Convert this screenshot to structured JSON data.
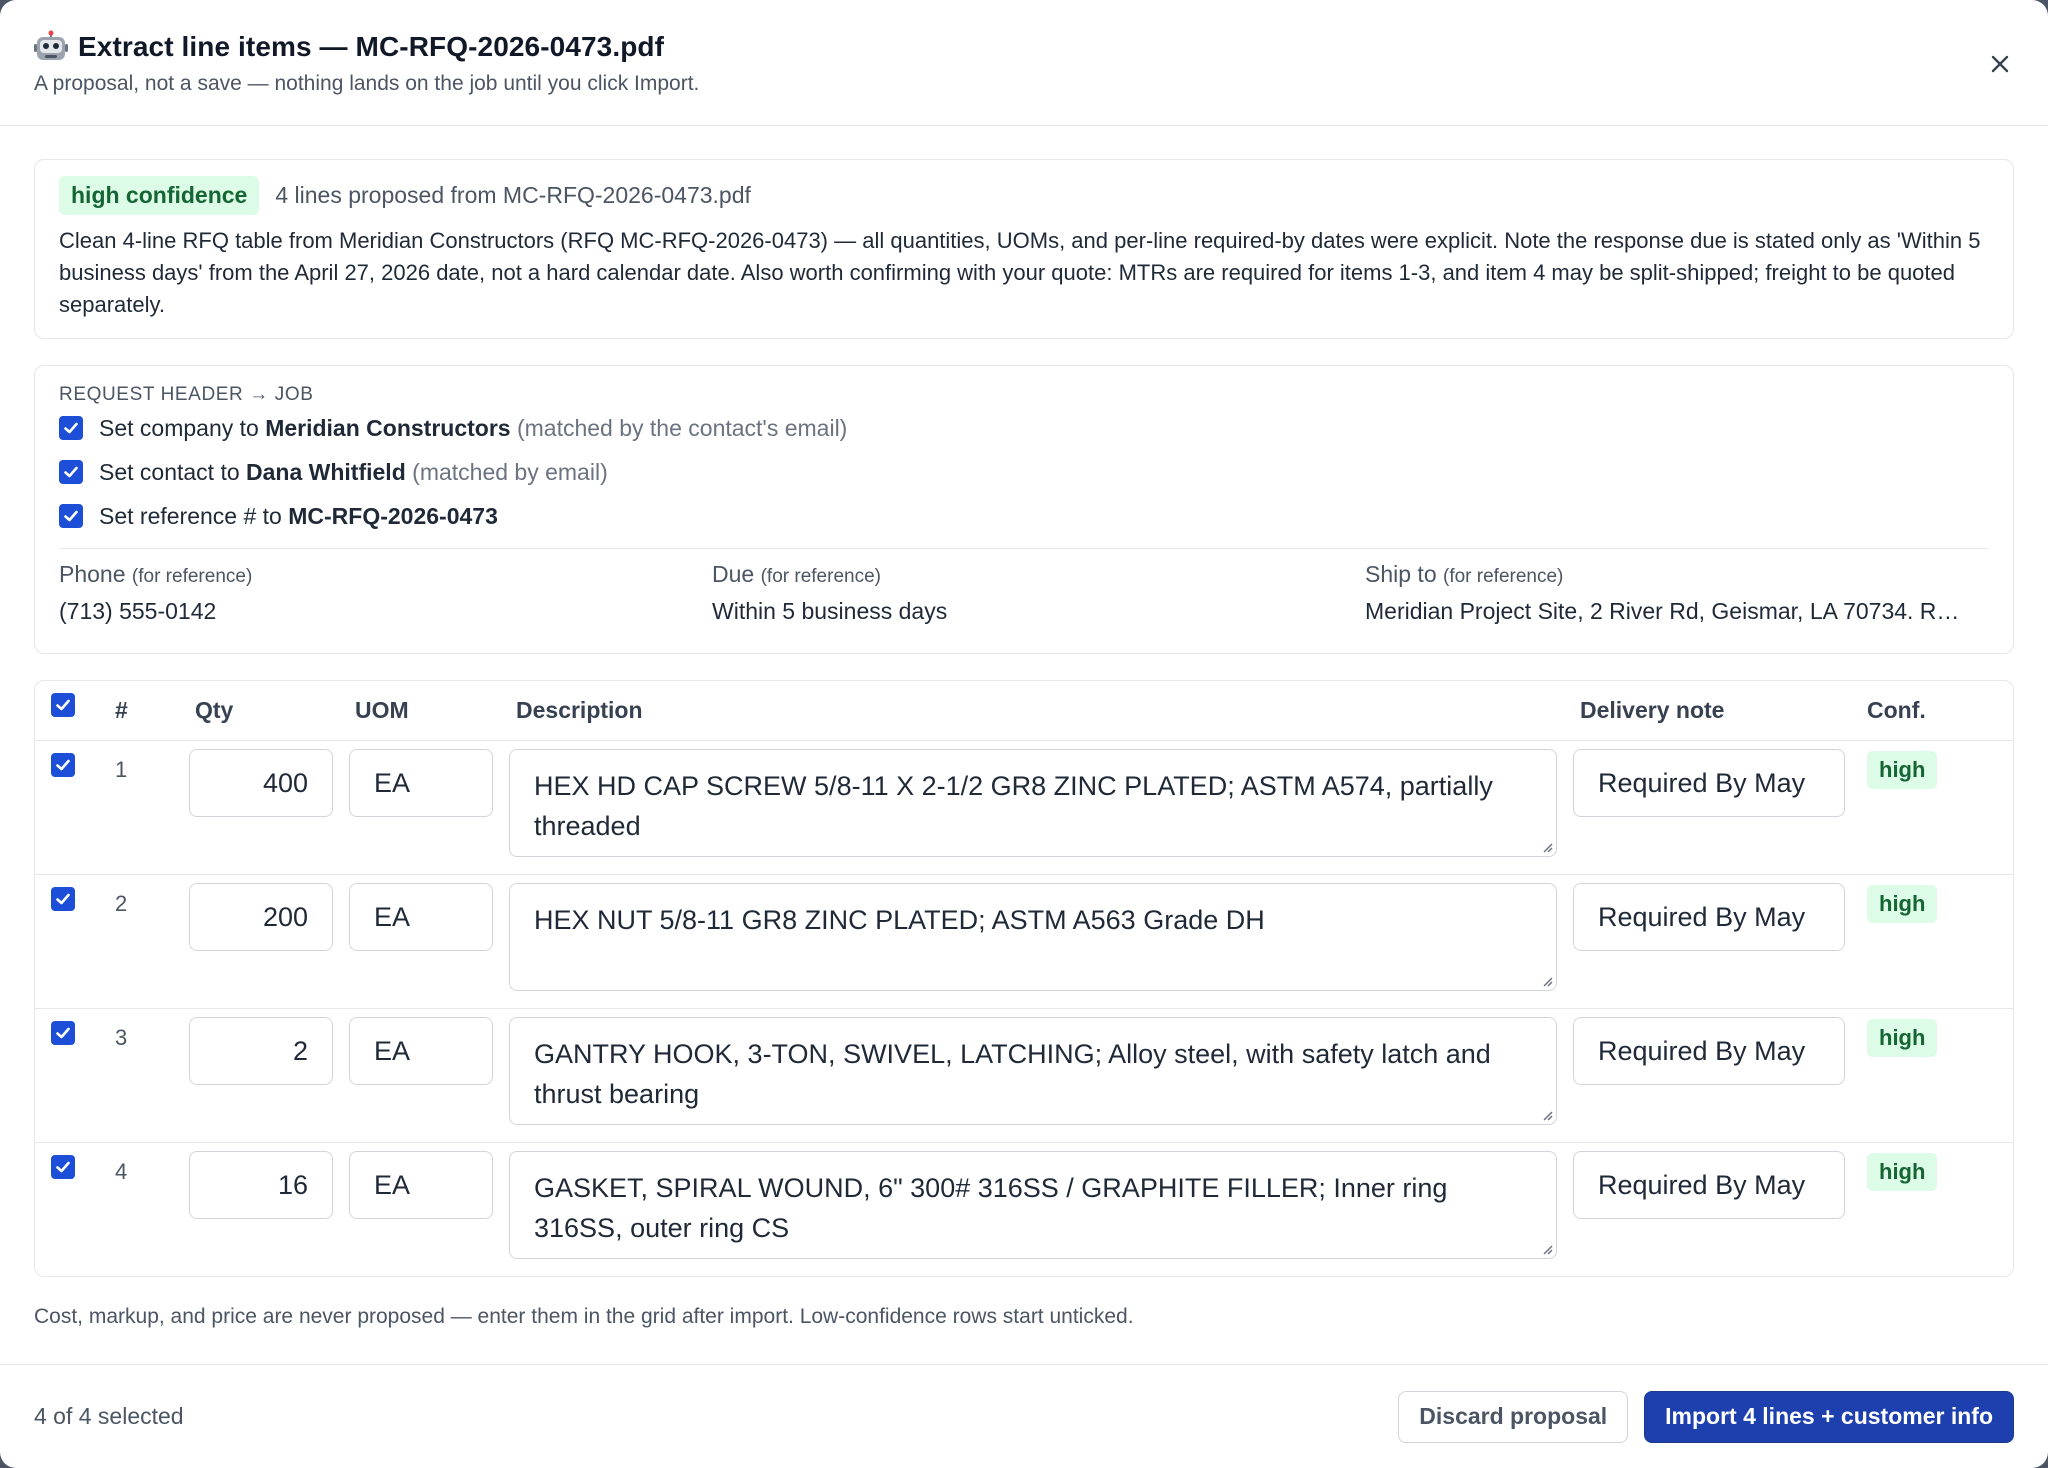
{
  "header": {
    "title": "Extract line items — MC-RFQ-2026-0473.pdf",
    "subtitle": "A proposal, not a save — nothing lands on the job until you click Import."
  },
  "summary": {
    "confidence": "high confidence",
    "meta": "4 lines proposed from MC-RFQ-2026-0473.pdf",
    "text": "Clean 4-line RFQ table from Meridian Constructors (RFQ MC-RFQ-2026-0473) — all quantities, UOMs, and per-line required-by dates were explicit. Note the response due is stated only as 'Within 5 business days' from the April 27, 2026 date, not a hard calendar date. Also worth confirming with your quote: MTRs are required for items 1-3, and item 4 may be split-shipped; freight to be quoted separately."
  },
  "request_header": {
    "label": "REQUEST HEADER → JOB",
    "company": {
      "prefix": "Set company to",
      "value": "Meridian Constructors",
      "note": "(matched by the contact's email)",
      "checked": true
    },
    "contact": {
      "prefix": "Set contact to",
      "value": "Dana Whitfield",
      "note": "(matched by email)",
      "checked": true
    },
    "reference": {
      "prefix": "Set reference # to",
      "value": "MC-RFQ-2026-0473",
      "checked": true
    },
    "refs": [
      {
        "label": "Phone",
        "note": "(for reference)",
        "value": "(713) 555-0142"
      },
      {
        "label": "Due",
        "note": "(for reference)",
        "value": "Within 5 business days"
      },
      {
        "label": "Ship to",
        "note": "(for reference)",
        "value": "Meridian Project Site, 2 River Rd, Geismar, LA 70734. R…"
      }
    ]
  },
  "table": {
    "columns": {
      "num": "#",
      "qty": "Qty",
      "uom": "UOM",
      "description": "Description",
      "delivery": "Delivery note",
      "conf": "Conf."
    },
    "rows": [
      {
        "num": "1",
        "qty": "400",
        "uom": "EA",
        "description": "HEX HD CAP SCREW 5/8-11 X 2-1/2 GR8 ZINC PLATED; ASTM A574, partially threaded",
        "delivery": "Required By May",
        "conf": "high",
        "checked": true
      },
      {
        "num": "2",
        "qty": "200",
        "uom": "EA",
        "description": "HEX NUT 5/8-11 GR8 ZINC PLATED; ASTM A563 Grade DH",
        "delivery": "Required By May",
        "conf": "high",
        "checked": true
      },
      {
        "num": "3",
        "qty": "2",
        "uom": "EA",
        "description": "GANTRY HOOK, 3-TON, SWIVEL, LATCHING; Alloy steel, with safety latch and thrust bearing",
        "delivery": "Required By May",
        "conf": "high",
        "checked": true
      },
      {
        "num": "4",
        "qty": "16",
        "uom": "EA",
        "description": "GASKET, SPIRAL WOUND, 6\" 300# 316SS / GRAPHITE FILLER; Inner ring 316SS, outer ring CS",
        "delivery": "Required By May",
        "conf": "high",
        "checked": true
      }
    ]
  },
  "footnote": "Cost, markup, and price are never proposed — enter them in the grid after import. Low-confidence rows start unticked.",
  "footer": {
    "selected": "4 of 4 selected",
    "discard_label": "Discard proposal",
    "import_label": "Import 4 lines + customer info"
  },
  "colors": {
    "accent": "#1e40af",
    "checkbox": "#1d4ed8",
    "confidence_bg": "#dcfce7",
    "confidence_text": "#166534"
  }
}
